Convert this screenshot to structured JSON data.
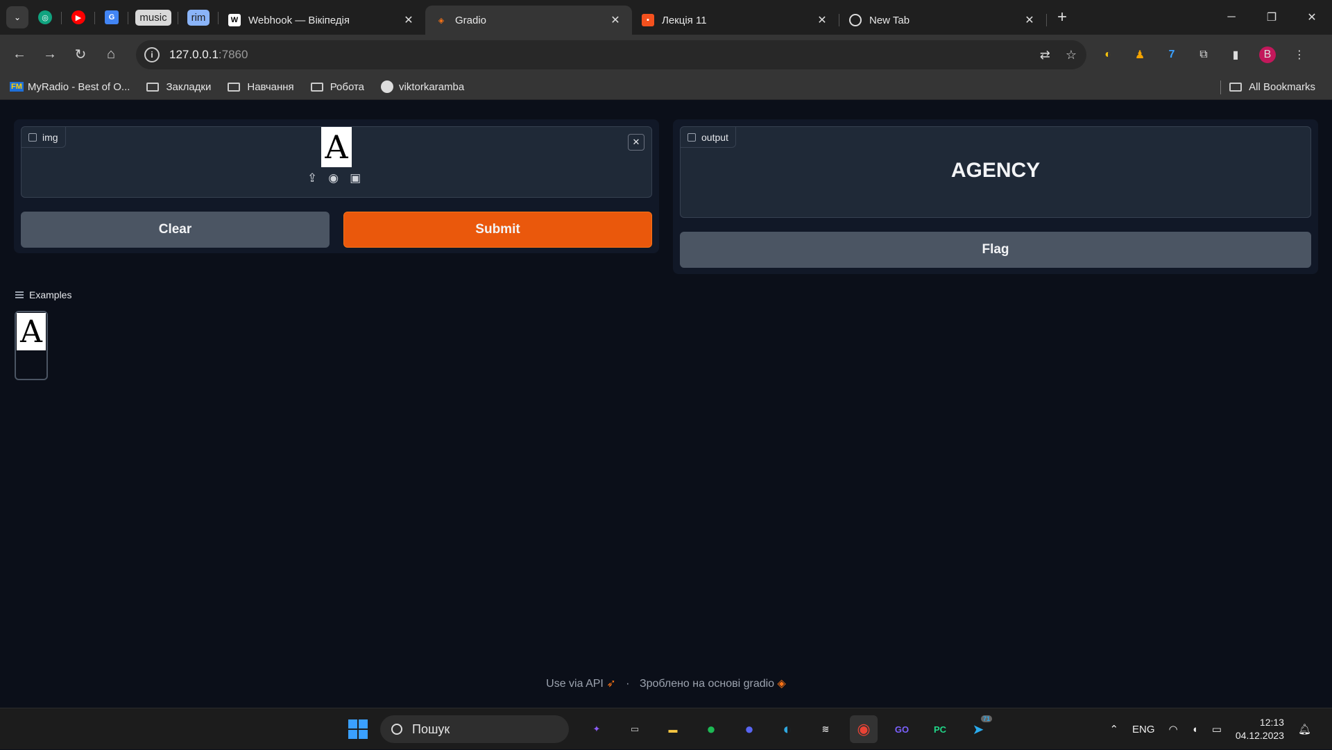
{
  "browser": {
    "pinned_labels": [
      "music",
      "rim"
    ],
    "tabs": [
      {
        "title": "Webhook — Вікіпедія",
        "active": false
      },
      {
        "title": "Gradio",
        "active": true
      },
      {
        "title": "Лекція 11",
        "active": false
      },
      {
        "title": "New Tab",
        "active": false
      }
    ],
    "url_host": "127.0.0.1",
    "url_port": ":7860",
    "bookmarks": [
      {
        "label": "MyRadio - Best of O...",
        "type": "site"
      },
      {
        "label": "Закладки",
        "type": "folder"
      },
      {
        "label": "Навчання",
        "type": "folder"
      },
      {
        "label": "Робота",
        "type": "folder"
      },
      {
        "label": "viktorkaramba",
        "type": "github"
      }
    ],
    "all_bookmarks": "All Bookmarks",
    "profile_initial": "B"
  },
  "gradio": {
    "input_label": "img",
    "input_image_letter": "A",
    "clear_label": "Clear",
    "submit_label": "Submit",
    "output_label": "output",
    "output_value": "AGENCY",
    "flag_label": "Flag",
    "examples_label": "Examples",
    "example_letter": "A",
    "footer_api": "Use via API",
    "footer_built": "Зроблено на основі gradio",
    "accent_color": "#ea580c"
  },
  "taskbar": {
    "search_placeholder": "Пошук",
    "language": "ENG",
    "time": "12:13",
    "date": "04.12.2023",
    "telegram_badge": "71"
  }
}
